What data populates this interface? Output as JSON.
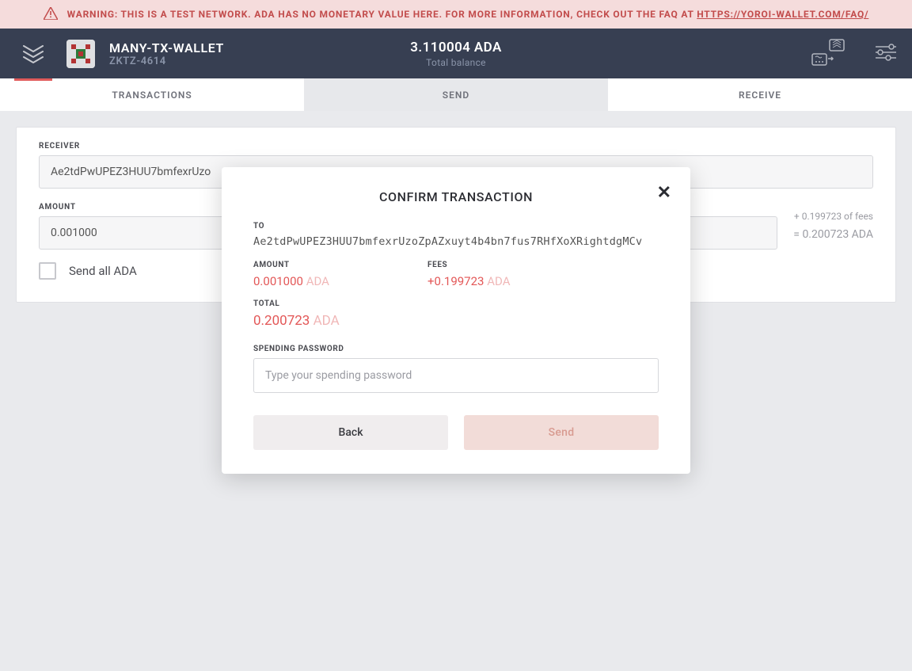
{
  "warning": {
    "prefix": "WARNING: THIS IS A TEST NETWORK. ADA HAS NO MONETARY VALUE HERE. FOR MORE INFORMATION, CHECK OUT THE FAQ AT ",
    "link": "HTTPS://YOROI-WALLET.COM/FAQ/"
  },
  "header": {
    "wallet_name": "MANY-TX-WALLET",
    "wallet_code": "ZKTZ-4614",
    "balance": "3.110004 ADA",
    "balance_label": "Total balance"
  },
  "tabs": {
    "transactions": "TRANSACTIONS",
    "send": "SEND",
    "receive": "RECEIVE"
  },
  "form": {
    "receiver_label": "RECEIVER",
    "receiver_value": "Ae2tdPwUPEZ3HUU7bmfexrUzo",
    "amount_label": "AMOUNT",
    "amount_value": "0.001000",
    "fees_note": "+ 0.199723 of fees",
    "equals_value": "= 0.200723 ADA",
    "send_all_label": "Send all ADA"
  },
  "modal": {
    "title": "CONFIRM TRANSACTION",
    "to_label": "TO",
    "to_value": "Ae2tdPwUPEZ3HUU7bmfexrUzoZpAZxuyt4b4bn7fus7RHfXoXRightdgMCv",
    "amount_label": "AMOUNT",
    "amount_value": "0.001000",
    "amount_currency": "ADA",
    "fees_label": "FEES",
    "fees_value": "+0.199723",
    "fees_currency": "ADA",
    "total_label": "TOTAL",
    "total_value": "0.200723",
    "total_currency": "ADA",
    "password_label": "SPENDING PASSWORD",
    "password_placeholder": "Type your spending password",
    "back_label": "Back",
    "send_label": "Send"
  }
}
